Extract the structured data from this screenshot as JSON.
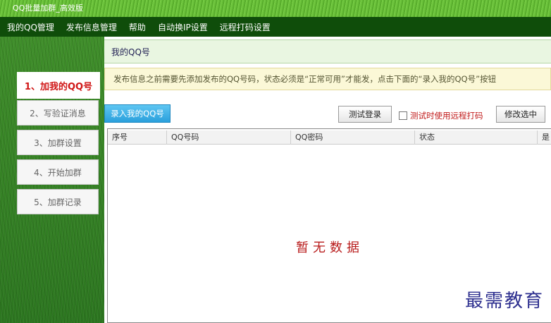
{
  "window": {
    "title": "QQ批量加群_高效版"
  },
  "menu": [
    "我的QQ管理",
    "发布信息管理",
    "帮助",
    "自动换IP设置",
    "远程打码设置"
  ],
  "sidebar": {
    "items": [
      {
        "label": "1、加我的QQ号",
        "active": true
      },
      {
        "label": "2、写验证消息",
        "active": false
      },
      {
        "label": "3、加群设置",
        "active": false
      },
      {
        "label": "4、开始加群",
        "active": false
      },
      {
        "label": "5、加群记录",
        "active": false
      }
    ]
  },
  "main": {
    "section_title": "我的QQ号",
    "notice": "发布信息之前需要先添加发布的QQ号码，状态必须是“正常可用”才能发，点击下面的“录入我的QQ号”按钮",
    "toolbar": {
      "add_label": "录入我的QQ号",
      "test_login_label": "测试登录",
      "remote_captcha_label": "测试时使用远程打码",
      "remote_captcha_checked": false,
      "edit_selected_label": "修改选中"
    },
    "table": {
      "columns": [
        "序号",
        "QQ号码",
        "QQ密码",
        "状态",
        "是"
      ],
      "rows": [],
      "empty_text": "暂无数据"
    }
  },
  "watermark": "最需教育",
  "colors": {
    "menubar": "#0f4d0a",
    "accent_red": "#d01616",
    "primary_button": "#2aa0dc",
    "header_bg": "#e9f6e1",
    "notice_bg": "#fbf8d7"
  }
}
